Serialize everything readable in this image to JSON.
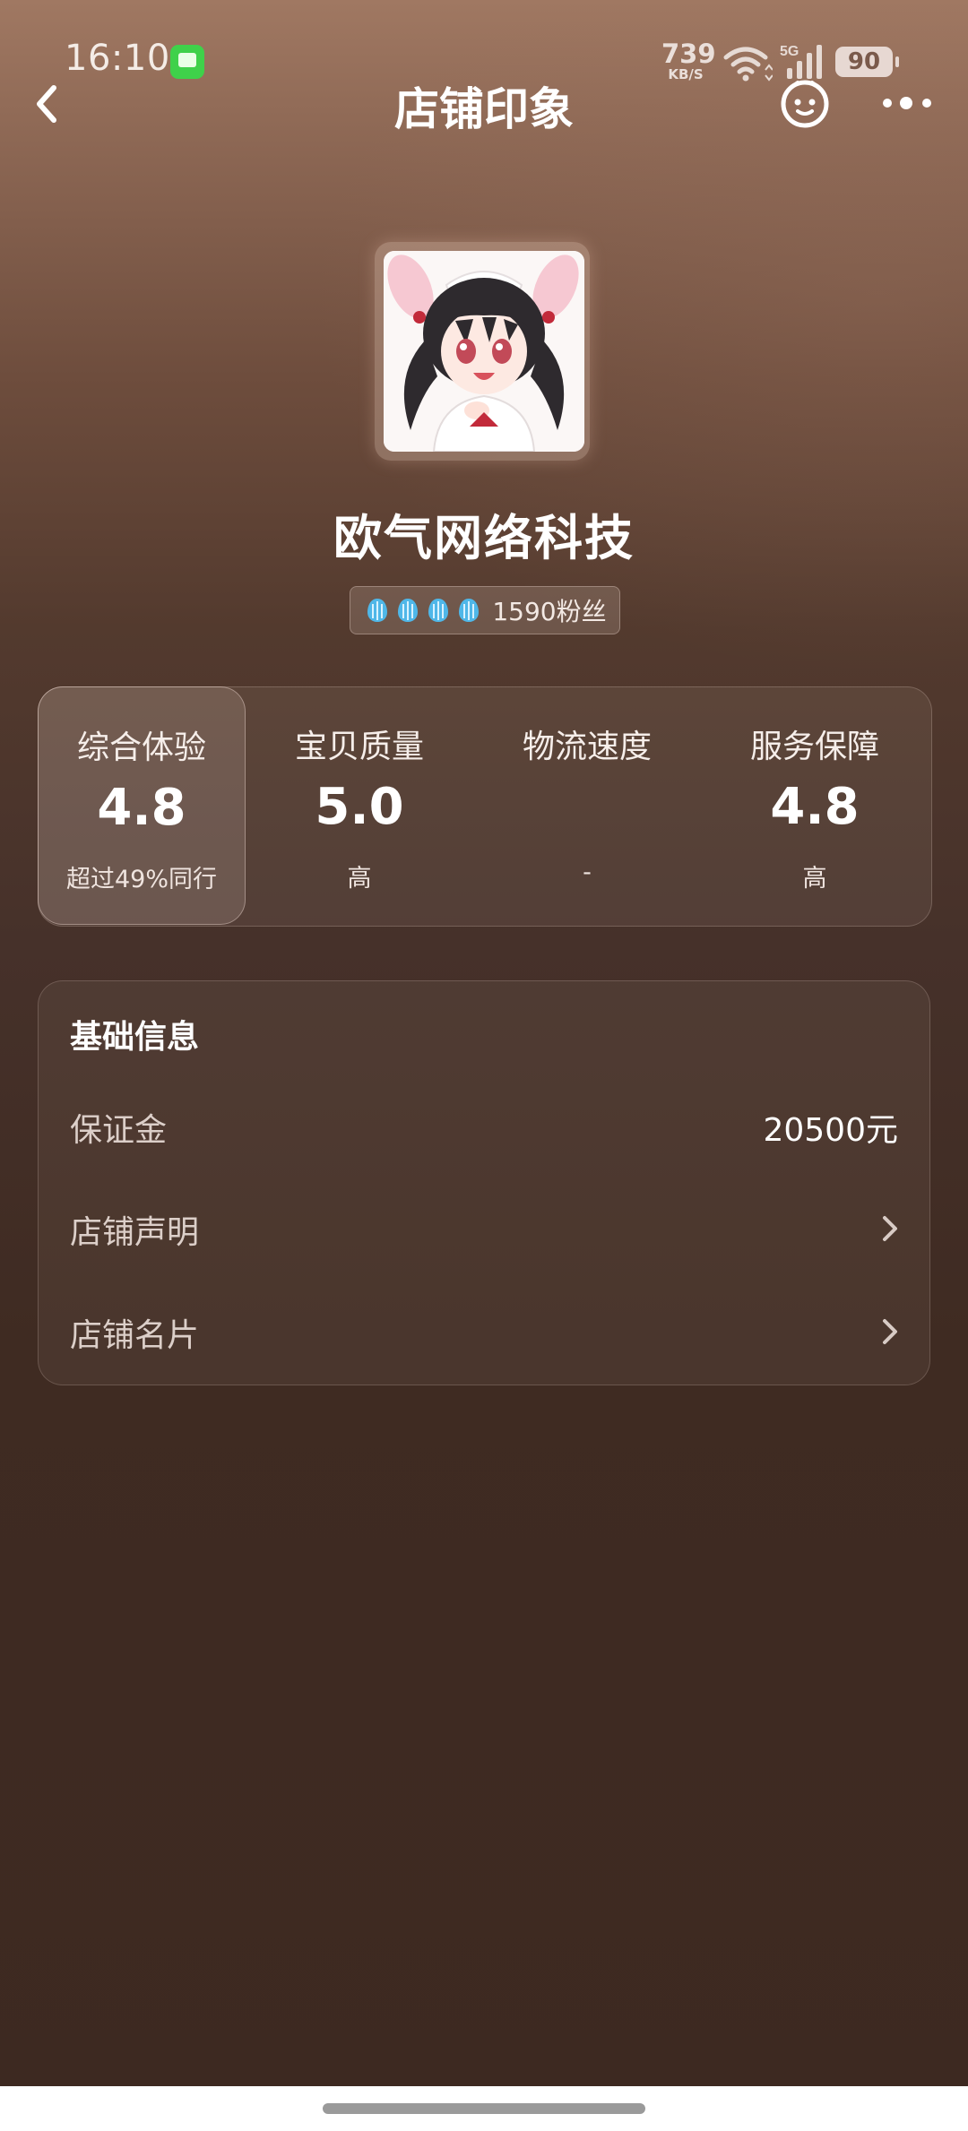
{
  "status_bar": {
    "time": "16:10",
    "net_speed_value": "739",
    "net_speed_unit": "KB/S",
    "network": "5G",
    "battery": "90"
  },
  "nav": {
    "title": "店铺印象",
    "back_icon": "chevron-left-icon",
    "service_icon": "smiley-service-icon",
    "more_icon": "more-dots-icon"
  },
  "shop": {
    "name": "欧气网络科技",
    "fans": "1590粉丝",
    "crown_count": 4,
    "crown_color": "#4fb7e8"
  },
  "scores": [
    {
      "label": "综合体验",
      "value": "4.8",
      "sub": "超过49%同行",
      "selected": true
    },
    {
      "label": "宝贝质量",
      "value": "5.0",
      "sub": "高",
      "selected": false
    },
    {
      "label": "物流速度",
      "value": "",
      "sub": "-",
      "selected": false
    },
    {
      "label": "服务保障",
      "value": "4.8",
      "sub": "高",
      "selected": false
    }
  ],
  "basic_info": {
    "title": "基础信息",
    "rows": [
      {
        "label": "保证金",
        "value": "20500元"
      },
      {
        "label": "店铺声明",
        "value": ""
      },
      {
        "label": "店铺名片",
        "value": ""
      }
    ]
  }
}
